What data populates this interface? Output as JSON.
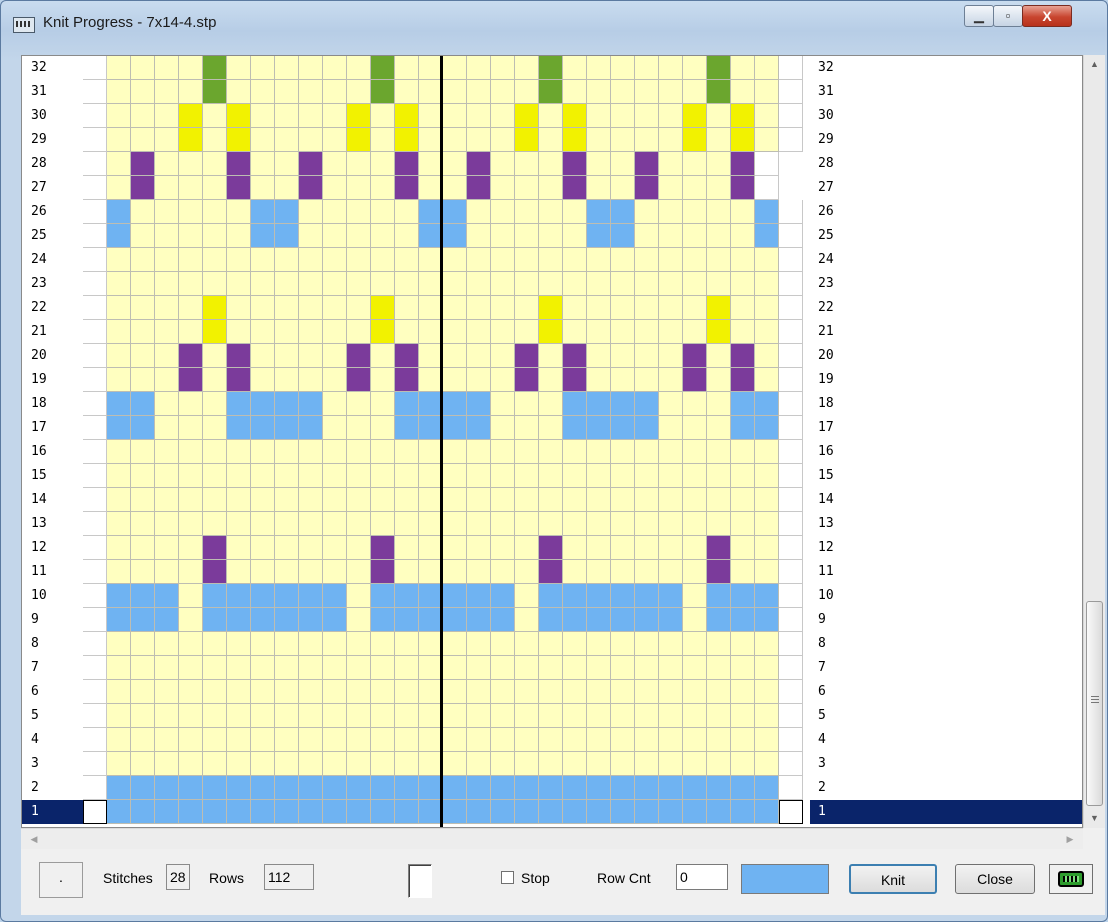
{
  "window": {
    "title": "Knit Progress - 7x14-4.stp"
  },
  "colors": {
    "background": "#FFFFC0",
    "blue": "#6FB3F2",
    "purple": "#7B3B9B",
    "yellow": "#F2F200",
    "green": "#6BA62E",
    "selected_row": "#0A246A"
  },
  "pattern": {
    "stitch_columns": 28,
    "rows": [
      {
        "num": "32",
        "cells": "....G......G......G......G.."
      },
      {
        "num": "31",
        "cells": "....G......G......G......G.."
      },
      {
        "num": "30",
        "cells": "...Y.Y....Y.Y....Y.Y....Y.Y."
      },
      {
        "num": "29",
        "cells": "...Y.Y....Y.Y....Y.Y....Y.Y."
      },
      {
        "num": "28",
        "cells": ".P...P..P...P..P...P..P...P"
      },
      {
        "num": "27",
        "cells": ".P...P..P...P..P...P..P...P"
      },
      {
        "num": "26",
        "cells": "B.....BB.....BB.....BB.....B"
      },
      {
        "num": "25",
        "cells": "B.....BB.....BB.....BB.....B"
      },
      {
        "num": "24",
        "cells": "............................"
      },
      {
        "num": "23",
        "cells": "............................"
      },
      {
        "num": "22",
        "cells": "....Y......Y......Y......Y.."
      },
      {
        "num": "21",
        "cells": "....Y......Y......Y......Y.."
      },
      {
        "num": "20",
        "cells": "...P.P....P.P....P.P....P.P."
      },
      {
        "num": "19",
        "cells": "...P.P....P.P....P.P....P.P."
      },
      {
        "num": "18",
        "cells": "BB...BBBB...BBBB...BBBB...BB"
      },
      {
        "num": "17",
        "cells": "BB...BBBB...BBBB...BBBB...BB"
      },
      {
        "num": "16",
        "cells": "............................"
      },
      {
        "num": "15",
        "cells": "............................"
      },
      {
        "num": "14",
        "cells": "............................"
      },
      {
        "num": "13",
        "cells": "............................"
      },
      {
        "num": "12",
        "cells": "....P......P......P......P.."
      },
      {
        "num": "11",
        "cells": "....P......P......P......P.."
      },
      {
        "num": "10",
        "cells": "BBB.BBBBBB.BBBBBB.BBBBBB.BBB"
      },
      {
        "num": "9",
        "cells": "BBB.BBBBBB.BBBBBB.BBBBBB.BBB"
      },
      {
        "num": "8",
        "cells": "............................"
      },
      {
        "num": "7",
        "cells": "............................"
      },
      {
        "num": "6",
        "cells": "............................"
      },
      {
        "num": "5",
        "cells": "............................"
      },
      {
        "num": "4",
        "cells": "............................"
      },
      {
        "num": "3",
        "cells": "............................"
      },
      {
        "num": "2",
        "cells": "BBBBBBBBBBBBBBBBBBBBBBBBBBBB"
      },
      {
        "num": "1",
        "cells": "BBBBBBBBBBBBBBBBBBBBBBBBBBBB"
      }
    ],
    "selected_row": "1"
  },
  "status": {
    "indicator": "·",
    "stitches_label": "Stitches",
    "stitches_value": "28",
    "rows_label": "Rows",
    "rows_value": "112",
    "stop_label": "Stop",
    "stop_checked": false,
    "rowcnt_label": "Row Cnt",
    "rowcnt_value": "0",
    "knit_label": "Knit",
    "close_label": "Close",
    "machine_icon": "knitting-machine-icon"
  }
}
